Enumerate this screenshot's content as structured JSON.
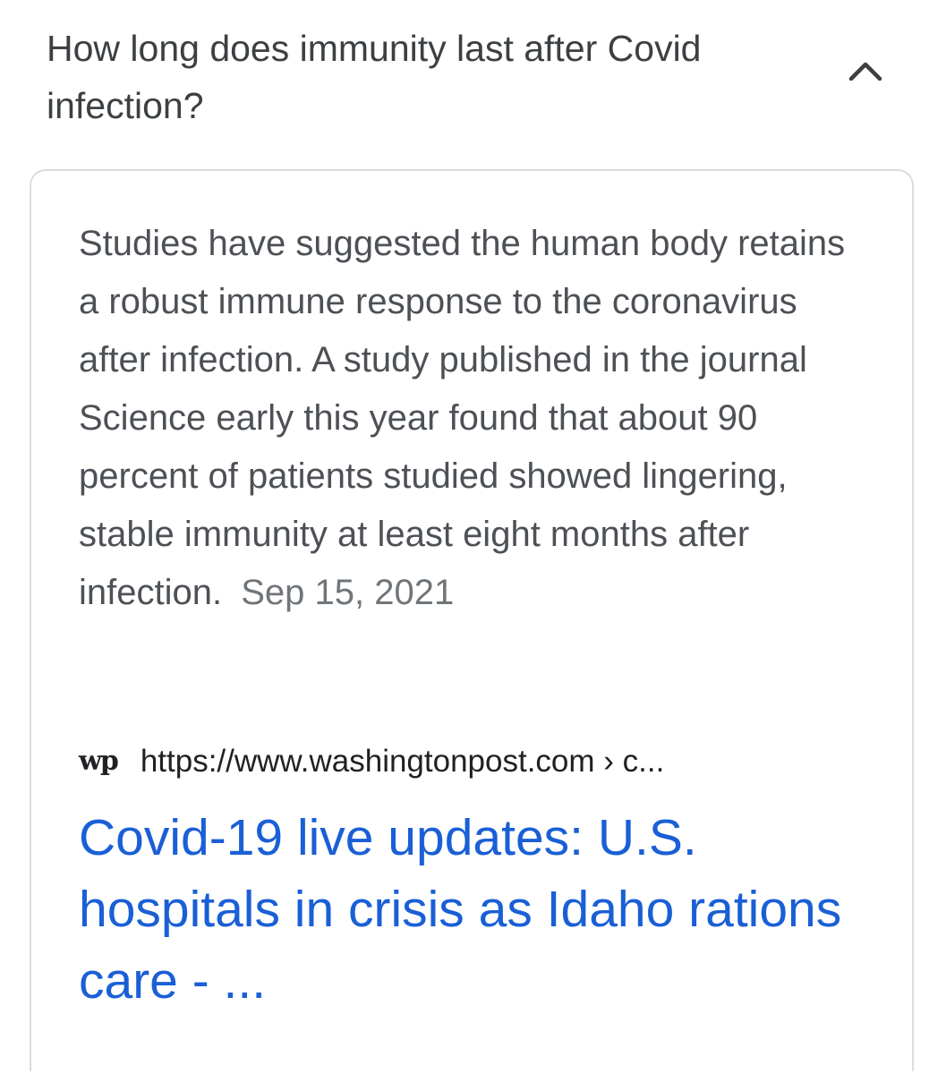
{
  "question": {
    "text": "How long does immunity last after Covid infection?",
    "expanded": true,
    "toggle_icon": "chevron-up-icon"
  },
  "answer": {
    "snippet": "Studies have suggested the human body retains a robust immune response to the coronavirus after infection. A study published in the journal Science early this year found that about 90 percent of patients studied showed lingering, stable immunity at least eight months after infection.",
    "date": "Sep 15, 2021"
  },
  "source": {
    "favicon_text": "wp",
    "favicon_icon": "washington-post-logo-icon",
    "url": "https://www.washingtonpost.com › c..."
  },
  "result": {
    "title": "Covid-19 live updates: U.S. hospitals in crisis as Idaho rations care - ..."
  },
  "colors": {
    "link": "#1a5fd6",
    "text": "#4d5156",
    "muted": "#70757a",
    "border": "#dadce0"
  }
}
